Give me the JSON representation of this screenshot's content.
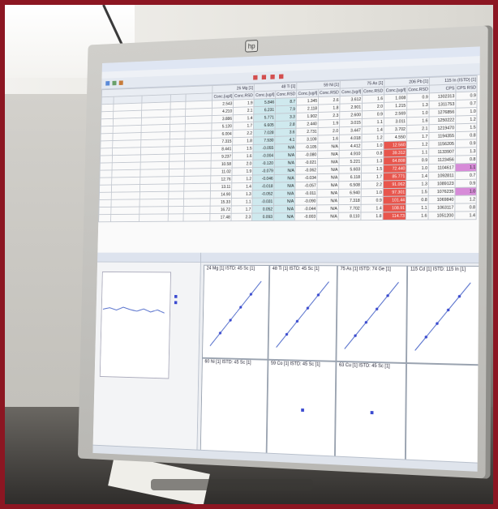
{
  "monitor": {
    "brand_logo": "hp"
  },
  "grid": {
    "group_headers": [
      "26 Mg [1]",
      "48 Ti [1]",
      "59 Ni [1]",
      "75 As [1]",
      "206 Pb [1]",
      "115 In (ISTD) [1]"
    ],
    "col_headers": [
      "Conc.[ug/l]",
      "Conc.RSD",
      "Conc.[ug/l]",
      "Conc.RSD",
      "Conc.[ug/l]",
      "Conc.RSD",
      "Conc.[ug/l]",
      "Conc.RSD",
      "Conc.[ug/l]",
      "Conc.RSD",
      "CPS",
      "CPS RSD"
    ],
    "rows": [
      [
        "2.543",
        "1.9",
        "5.846",
        "8.7",
        "1.345",
        "2.6",
        "3.612",
        "1.6",
        "1.008",
        "0.9",
        "1302313",
        "0.9"
      ],
      [
        "4.210",
        "2.1",
        "6.231",
        "7.9",
        "2.118",
        "1.8",
        "2.901",
        "2.0",
        "1.215",
        "1.3",
        "1311753",
        "0.7"
      ],
      [
        "3.886",
        "1.4",
        "5.771",
        "3.3",
        "1.902",
        "2.3",
        "2.600",
        "0.9",
        "2.569",
        "1.0",
        "1276856",
        "1.0"
      ],
      [
        "5.120",
        "1.7",
        "6.605",
        "2.8",
        "2.440",
        "1.9",
        "3.015",
        "1.1",
        "3.011",
        "1.6",
        "1250222",
        "1.2"
      ],
      [
        "6.004",
        "2.2",
        "7.028",
        "3.6",
        "2.731",
        "2.0",
        "3.447",
        "1.4",
        "3.702",
        "2.1",
        "1219470",
        "1.5"
      ],
      [
        "7.315",
        "1.8",
        "7.930",
        "4.1",
        "3.109",
        "1.6",
        "4.018",
        "1.2",
        "4.550",
        "1.7",
        "1194355",
        "0.8"
      ],
      [
        "8.441",
        "1.5",
        "-0.055",
        "N/A",
        "-0.105",
        "N/A",
        "4.412",
        "1.0",
        "12.560",
        "1.2",
        "1156205",
        "0.9"
      ],
      [
        "9.237",
        "1.6",
        "-0.004",
        "N/A",
        "-0.080",
        "N/A",
        "4.910",
        "0.8",
        "39.312",
        "1.1",
        "1133907",
        "1.3"
      ],
      [
        "10.58",
        "2.0",
        "-0.120",
        "N/A",
        "-0.021",
        "N/A",
        "5.221",
        "1.3",
        "64.808",
        "0.9",
        "1123456",
        "0.8"
      ],
      [
        "11.02",
        "1.9",
        "-0.079",
        "N/A",
        "-0.062",
        "N/A",
        "5.603",
        "1.5",
        "72.440",
        "1.0",
        "1104617",
        "1.1"
      ],
      [
        "12.76",
        "1.2",
        "-0.046",
        "N/A",
        "-0.034",
        "N/A",
        "6.118",
        "1.7",
        "85.771",
        "1.4",
        "1092811",
        "0.7"
      ],
      [
        "13.11",
        "1.4",
        "-0.018",
        "N/A",
        "-0.057",
        "N/A",
        "6.508",
        "2.2",
        "91.062",
        "1.3",
        "1089123",
        "0.9"
      ],
      [
        "14.90",
        "1.3",
        "-0.052",
        "N/A",
        "-0.011",
        "N/A",
        "6.940",
        "1.0",
        "97.301",
        "1.5",
        "1076235",
        "1.0"
      ],
      [
        "15.33",
        "1.1",
        "-0.031",
        "N/A",
        "-0.090",
        "N/A",
        "7.318",
        "0.9",
        "101.44",
        "0.8",
        "1069840",
        "1.2"
      ],
      [
        "16.72",
        "1.7",
        "0.052",
        "N/A",
        "-0.044",
        "N/A",
        "7.702",
        "1.4",
        "108.91",
        "1.1",
        "1063117",
        "0.8"
      ],
      [
        "17.48",
        "2.3",
        "0.093",
        "N/A",
        "-0.003",
        "N/A",
        "8.110",
        "1.8",
        "114.73",
        "1.6",
        "1051200",
        "1.4"
      ]
    ],
    "red_cells": [
      [
        6,
        8
      ],
      [
        7,
        8
      ],
      [
        8,
        8
      ],
      [
        9,
        8
      ],
      [
        10,
        8
      ],
      [
        11,
        8
      ],
      [
        12,
        8
      ],
      [
        13,
        8
      ],
      [
        14,
        8
      ],
      [
        15,
        8
      ]
    ],
    "pink_cells": [
      [
        9,
        11
      ],
      [
        12,
        11
      ]
    ],
    "cyan_col": 2
  },
  "plots": [
    {
      "title": "24 Mg [1] ISTD: 45 Sc [1]"
    },
    {
      "title": "48 Ti [1] ISTD: 45 Sc [1]"
    },
    {
      "title": "75 As [1] ISTD: 74 Ge [1]"
    },
    {
      "title": "115 Cd [1] ISTD: 115 In [1]"
    },
    {
      "title": "60 Ni [1] ISTD: 45 Sc [1]"
    },
    {
      "title": "59 Co [1] ISTD: 45 Sc [1]"
    },
    {
      "title": "63 Cu [1] ISTD: 45 Sc [1]"
    },
    {
      "title": ""
    }
  ]
}
